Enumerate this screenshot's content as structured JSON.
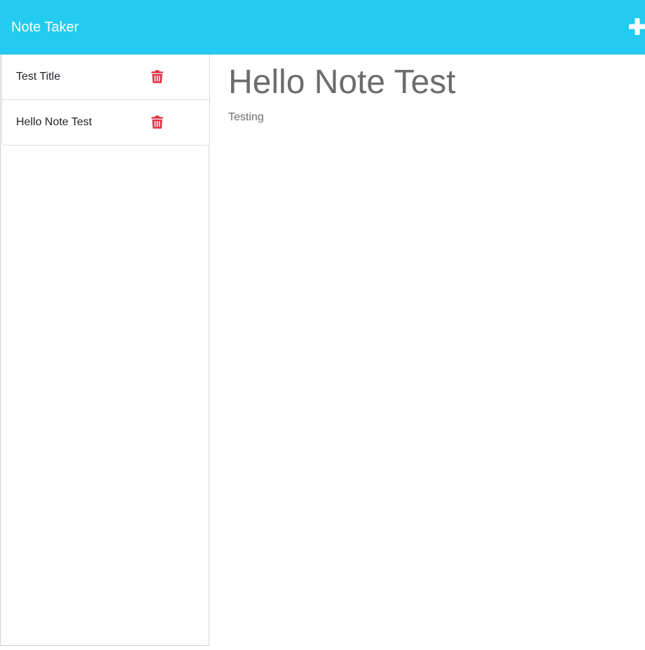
{
  "app": {
    "title": "Note Taker",
    "accent_color": "#22cbef",
    "delete_color": "#dc3545"
  },
  "toolbar": {
    "new_note_icon": "plus-icon"
  },
  "sidebar": {
    "notes": [
      {
        "title": "Test Title",
        "delete_icon": "trash-icon"
      },
      {
        "title": "Hello Note Test",
        "delete_icon": "trash-icon"
      }
    ]
  },
  "editor": {
    "title": "Hello Note Test",
    "text": "Testing"
  }
}
